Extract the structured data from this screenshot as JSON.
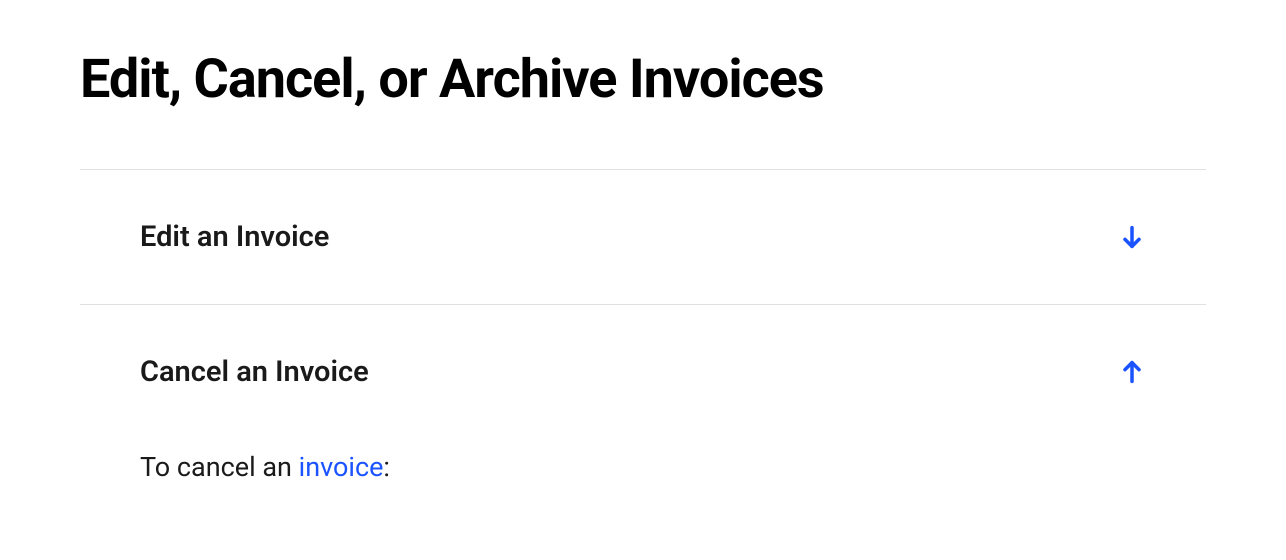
{
  "page": {
    "title": "Edit, Cancel, or Archive Invoices"
  },
  "accordion": {
    "items": [
      {
        "title": "Edit an Invoice",
        "expanded": false
      },
      {
        "title": "Cancel an Invoice",
        "expanded": true,
        "body": {
          "prefix": "To cancel an ",
          "link_text": "invoice",
          "suffix": ":"
        }
      }
    ]
  }
}
